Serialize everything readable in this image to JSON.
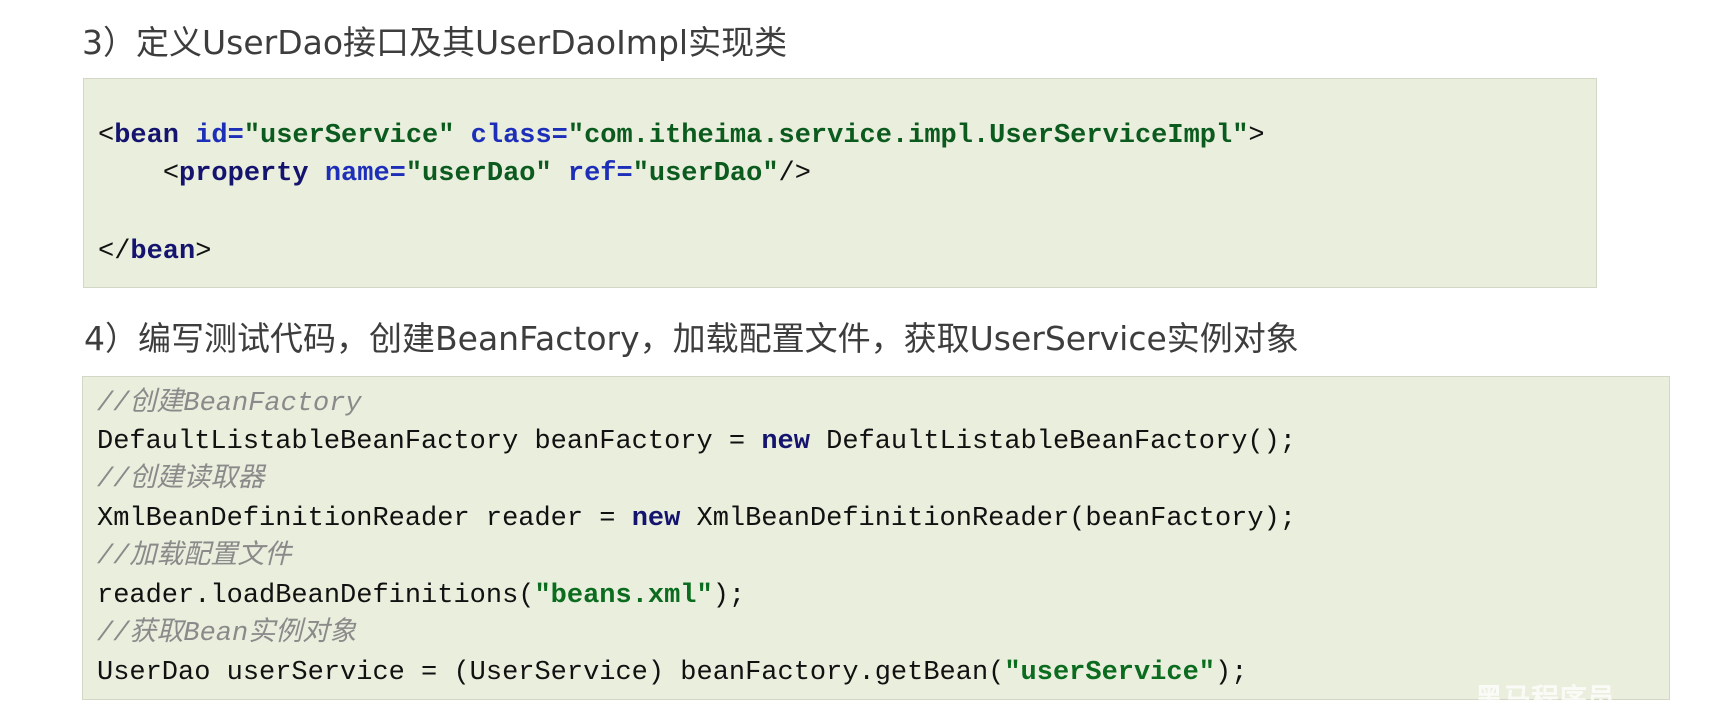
{
  "section3": {
    "heading": "3）定义UserDao接口及其UserDaoImpl实现类"
  },
  "xml_code": {
    "line1": {
      "open": "<",
      "tag": "bean",
      "attr_id": "id=",
      "val_id": "\"userService\"",
      "attr_class": "class=",
      "val_class": "\"com.itheima.service.impl.UserServiceImpl\"",
      "close": ">"
    },
    "line2": {
      "open": "<",
      "tag": "property",
      "attr_name": "name=",
      "val_name": "\"userDao\"",
      "attr_ref": "ref=",
      "val_ref": "\"userDao\"",
      "close": "/>"
    },
    "line3": {
      "open": "</",
      "tag": "bean",
      "close": ">"
    }
  },
  "section4": {
    "heading": "4）编写测试代码，创建BeanFactory，加载配置文件，获取UserService实例对象"
  },
  "java_code": {
    "c1": "//创建BeanFactory",
    "l1a": "DefaultListableBeanFactory beanFactory = ",
    "l1kw": "new",
    "l1b": " DefaultListableBeanFactory();",
    "c2": "//创建读取器",
    "l2a": "XmlBeanDefinitionReader reader = ",
    "l2kw": "new",
    "l2b": " XmlBeanDefinitionReader(beanFactory);",
    "c3": "//加载配置文件",
    "l3a": "reader.loadBeanDefinitions(",
    "l3str": "\"beans.xml\"",
    "l3b": ");",
    "c4": "//获取Bean实例对象",
    "l4a": "UserDao userService = (UserService) beanFactory.getBean(",
    "l4str": "\"userService\"",
    "l4b": ");"
  },
  "watermark": {
    "text": "黑马程序员"
  }
}
